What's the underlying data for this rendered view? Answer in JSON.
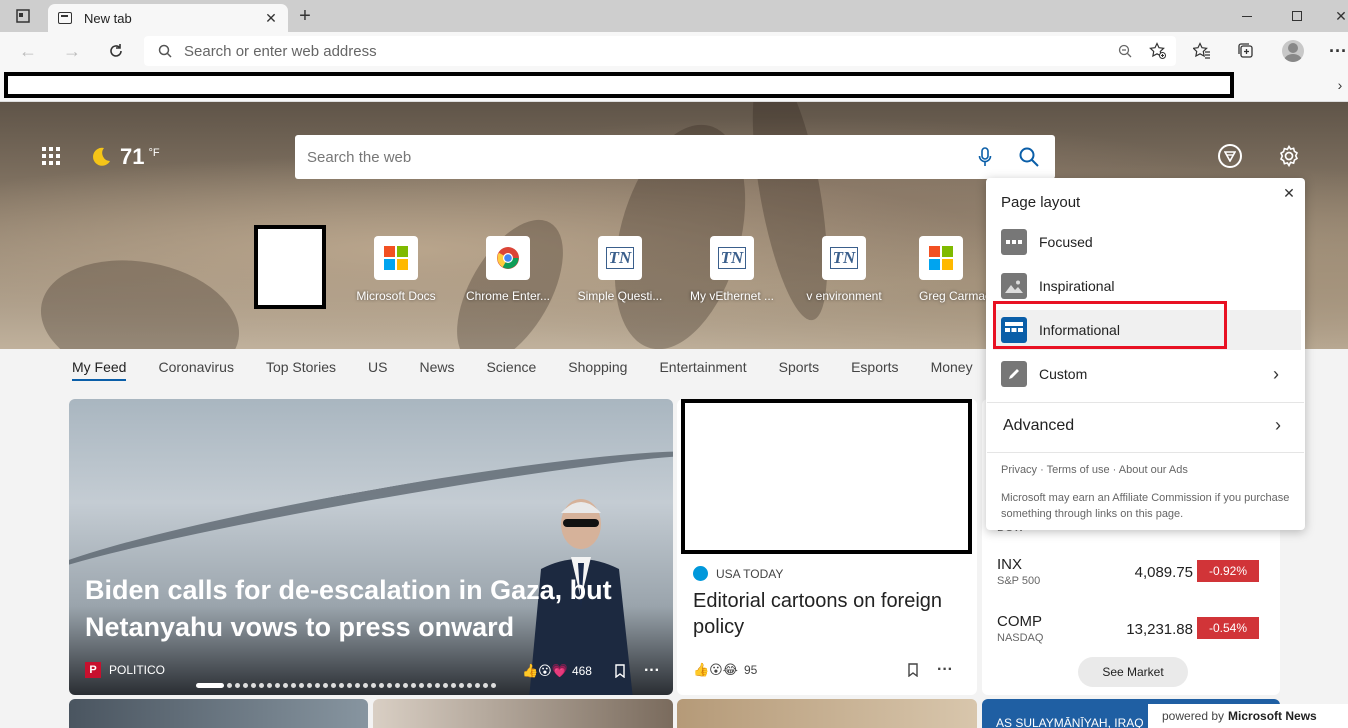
{
  "browser": {
    "tab_title": "New tab",
    "address_placeholder": "Search or enter web address"
  },
  "weather": {
    "temperature": "71",
    "unit": "°F"
  },
  "web_search": {
    "placeholder": "Search the web"
  },
  "quick_links": [
    {
      "label": "Microsoft Docs",
      "icon": "microsoft-logo"
    },
    {
      "label": "Chrome Enter...",
      "icon": "chrome-logo"
    },
    {
      "label": "Simple Questi...",
      "icon": "tn-logo"
    },
    {
      "label": "My vEthernet ...",
      "icon": "tn-logo"
    },
    {
      "label": "v environment",
      "icon": "tn-logo"
    },
    {
      "label": "Greg Carmac",
      "icon": "microsoft-logo"
    }
  ],
  "feed_nav": [
    "My Feed",
    "Coronavirus",
    "Top Stories",
    "US",
    "News",
    "Science",
    "Shopping",
    "Entertainment",
    "Sports",
    "Esports",
    "Money"
  ],
  "card1": {
    "headline": "Biden calls for de-escalation in Gaza, but Netanyahu vows to press onward",
    "source": "POLITICO",
    "source_logo": "P",
    "reactions": "468"
  },
  "card2": {
    "source": "USA TODAY",
    "headline": "Editorial cartoons on foreign policy",
    "reactions": "95"
  },
  "markets": {
    "cut_label": "DOW",
    "stocks": [
      {
        "symbol": "INX",
        "name": "S&P 500",
        "value": "4,089.75",
        "change": "-0.92%"
      },
      {
        "symbol": "COMP",
        "name": "NASDAQ",
        "value": "13,231.88",
        "change": "-0.54%"
      }
    ],
    "see_market": "See Market"
  },
  "bottom": {
    "card4_text": "AS SULAYMĀNĪYAH, IRAQ",
    "powered_prefix": "powered by",
    "powered_brand": "Microsoft News"
  },
  "page_layout_panel": {
    "title": "Page layout",
    "options": [
      "Focused",
      "Inspirational",
      "Informational",
      "Custom"
    ],
    "advanced": "Advanced",
    "links": "Privacy · Terms of use · About our Ads",
    "affiliate": "Microsoft may earn an Affiliate Commission if you purchase something through links on this page."
  },
  "colors": {
    "accent": "#0a5ea8",
    "highlight": "#e81123",
    "negative": "#d13438"
  }
}
